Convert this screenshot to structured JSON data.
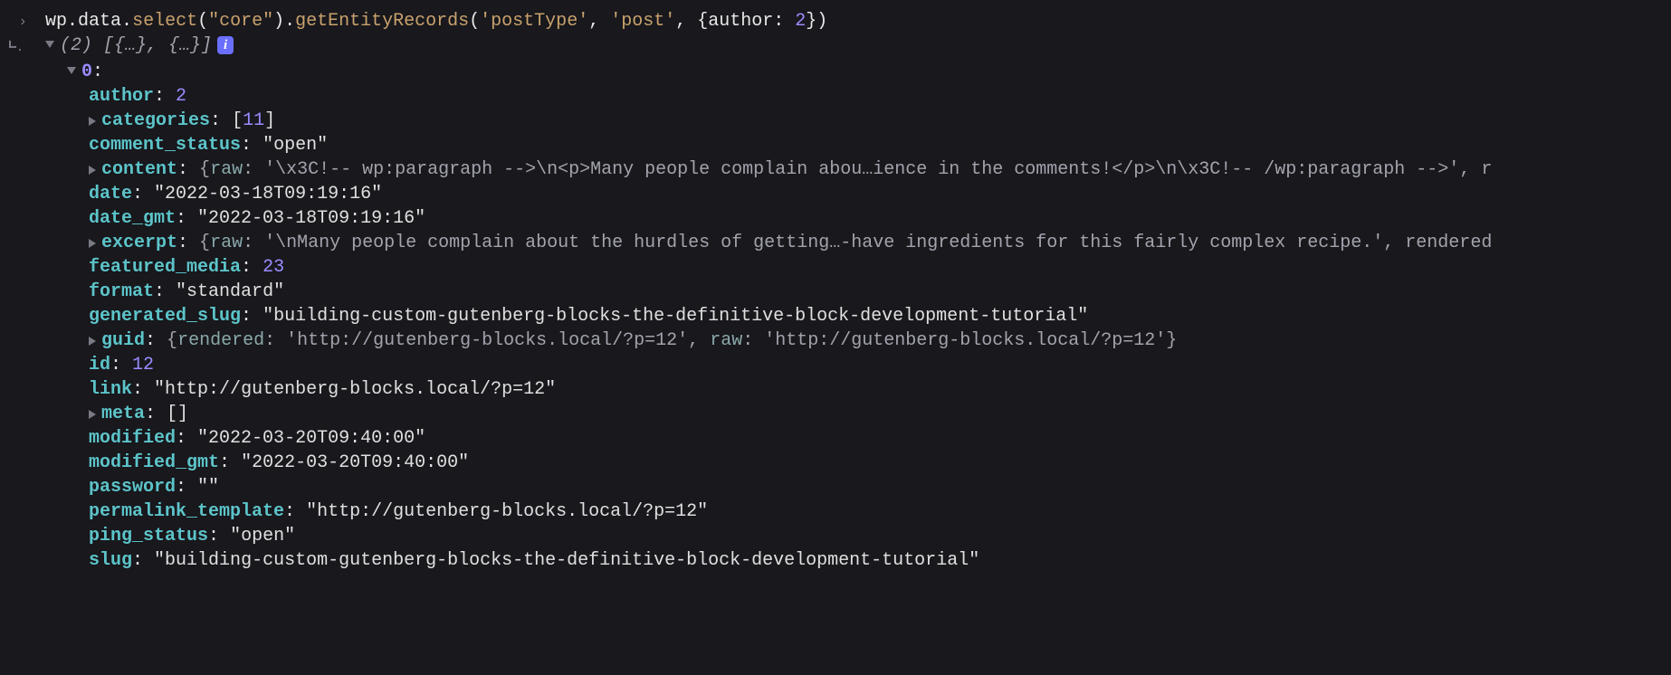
{
  "input": {
    "parts": {
      "p1": "wp",
      "p2": "data",
      "p3": "select",
      "p4": "\"core\"",
      "p5": "getEntityRecords",
      "p6": "'postType'",
      "p7": "'post'",
      "p8a": "author",
      "p8b": "2"
    }
  },
  "result": {
    "length": "(2)",
    "preview": "[{…}, {…}]",
    "info": "i"
  },
  "obj": {
    "index": "0",
    "colon": ":",
    "author_k": "author",
    "author_v": "2",
    "categories_k": "categories",
    "categories_open": "[",
    "categories_v": "11",
    "categories_close": "]",
    "comment_status_k": "comment_status",
    "comment_status_v": "\"open\"",
    "content_k": "content",
    "content_open": "{",
    "content_raw_k": "raw",
    "content_raw_v": "'\\x3C!-- wp:paragraph -->\\n<p>Many people complain abou…ience in the comments!</p>\\n\\x3C!-- /wp:paragraph -->'",
    "content_trail": ", r",
    "date_k": "date",
    "date_v": "\"2022-03-18T09:19:16\"",
    "date_gmt_k": "date_gmt",
    "date_gmt_v": "\"2022-03-18T09:19:16\"",
    "excerpt_k": "excerpt",
    "excerpt_open": "{",
    "excerpt_raw_k": "raw",
    "excerpt_raw_v": "'\\nMany people complain about the hurdles of getting…-have ingredients for this fairly complex recipe.'",
    "excerpt_trail": ", rendered",
    "featured_media_k": "featured_media",
    "featured_media_v": "23",
    "format_k": "format",
    "format_v": "\"standard\"",
    "generated_slug_k": "generated_slug",
    "generated_slug_v": "\"building-custom-gutenberg-blocks-the-definitive-block-development-tutorial\"",
    "guid_k": "guid",
    "guid_open": "{",
    "guid_rendered_k": "rendered",
    "guid_rendered_v": "'http://gutenberg-blocks.local/?p=12'",
    "guid_raw_k": "raw",
    "guid_raw_v": "'http://gutenberg-blocks.local/?p=12'",
    "guid_close": "}",
    "id_k": "id",
    "id_v": "12",
    "link_k": "link",
    "link_v": "\"http://gutenberg-blocks.local/?p=12\"",
    "meta_k": "meta",
    "meta_v": "[]",
    "modified_k": "modified",
    "modified_v": "\"2022-03-20T09:40:00\"",
    "modified_gmt_k": "modified_gmt",
    "modified_gmt_v": "\"2022-03-20T09:40:00\"",
    "password_k": "password",
    "password_v": "\"\"",
    "permalink_template_k": "permalink_template",
    "permalink_template_v": "\"http://gutenberg-blocks.local/?p=12\"",
    "ping_status_k": "ping_status",
    "ping_status_v": "\"open\"",
    "slug_k": "slug",
    "slug_v": "\"building-custom-gutenberg-blocks-the-definitive-block-development-tutorial\""
  }
}
